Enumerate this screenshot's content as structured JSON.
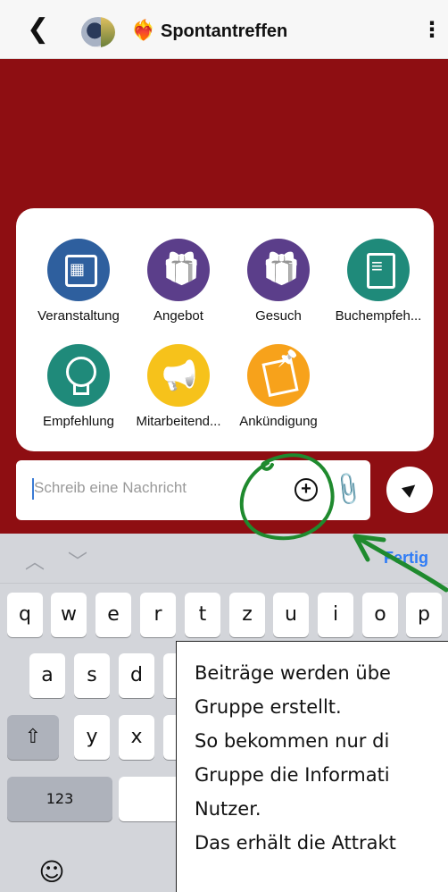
{
  "header": {
    "back_icon": "chevron-left-icon",
    "title": "Spontantreffen",
    "title_emoji": "❤️‍🔥",
    "menu_icon": "more-vertical-icon"
  },
  "post_types": [
    {
      "label": "Veranstaltung",
      "icon": "calendar-icon",
      "color": "#2e5f9e"
    },
    {
      "label": "Angebot",
      "icon": "gift-icon",
      "color": "#5b3e8a"
    },
    {
      "label": "Gesuch",
      "icon": "gift-icon",
      "color": "#5b3e8a"
    },
    {
      "label": "Buchempfeh...",
      "icon": "book-icon",
      "color": "#1f8a7a"
    },
    {
      "label": "Empfehlung",
      "icon": "lightbulb-icon",
      "color": "#1f8a7a"
    },
    {
      "label": "Mitarbeitend...",
      "icon": "megaphone-icon",
      "color": "#f6c21b"
    },
    {
      "label": "Ankündigung",
      "icon": "note-pin-icon",
      "color": "#f7a21b"
    }
  ],
  "composer": {
    "placeholder": "Schreib eine Nachricht",
    "plus_icon": "plus-circle-icon",
    "attach_icon": "paperclip-icon",
    "send_icon": "send-icon"
  },
  "keyboard": {
    "done_label": "Fertig",
    "row1": [
      "q",
      "w",
      "e",
      "r",
      "t",
      "z",
      "u",
      "i",
      "o",
      "p"
    ],
    "row2": [
      "a",
      "s",
      "d"
    ],
    "row3": [
      "y",
      "x"
    ],
    "numbers_label": "123",
    "emoji_icon": "emoji-icon",
    "shift_icon": "shift-icon"
  },
  "overlay_note": {
    "lines": [
      "Beiträge werden übe",
      "Gruppe erstellt.",
      "So bekommen nur di",
      "Gruppe die Informati",
      "Nutzer.",
      "Das erhält die Attrakt"
    ]
  },
  "colors": {
    "chat_background": "#8e0e12",
    "annotation_green": "#1f8a2e",
    "accent_blue": "#2f7cf6"
  }
}
